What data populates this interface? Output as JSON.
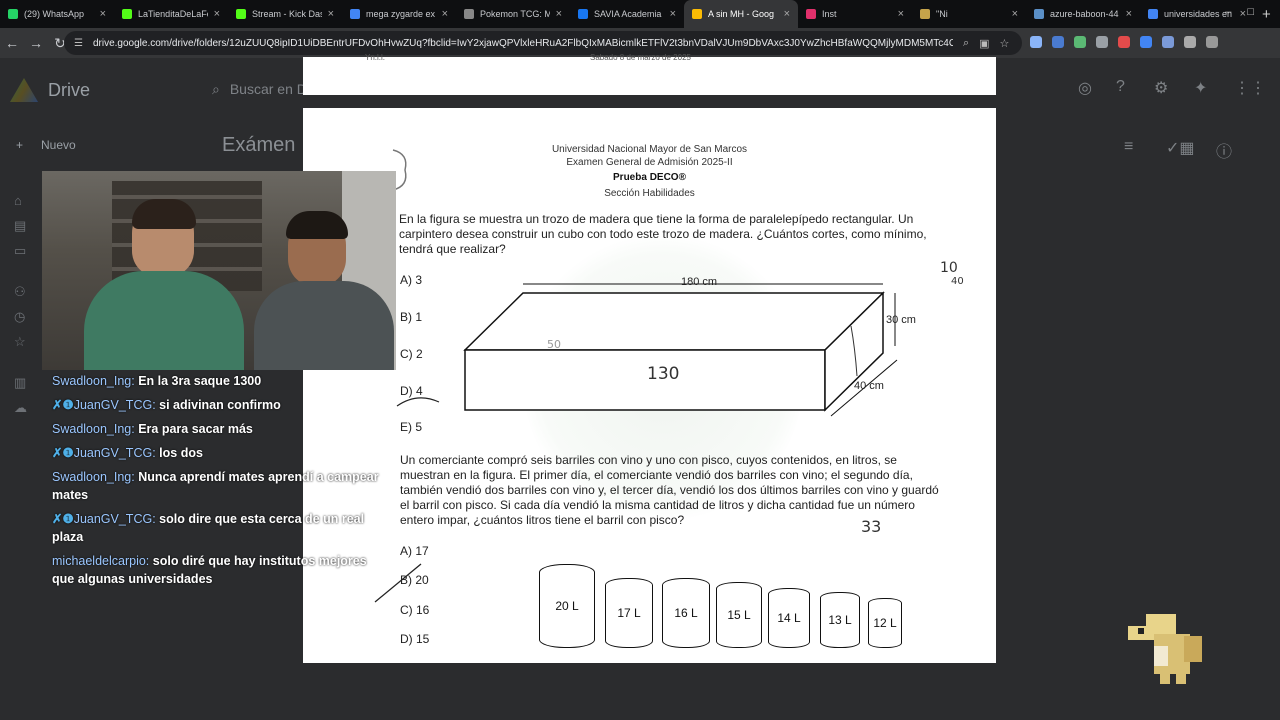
{
  "tabs": [
    {
      "title": "(29) WhatsApp",
      "color": "#25d366"
    },
    {
      "title": "LaTienditaDeLaFo",
      "color": "#53fc18"
    },
    {
      "title": "Stream - Kick Das",
      "color": "#53fc18"
    },
    {
      "title": "mega zygarde ex",
      "color": "#4285f4"
    },
    {
      "title": "Pokemon TCG: M",
      "color": "#888888"
    },
    {
      "title": "SAVIA Academia",
      "color": "#1877f2"
    },
    {
      "title": "A sin MH - Goog",
      "color": "#fbbc04",
      "active": true
    },
    {
      "title": "Inst",
      "color": "#e1306c"
    },
    {
      "title": "\"Ni",
      "color": "#c5a34a"
    },
    {
      "title": "azure-baboon-44",
      "color": "#5a8fc7"
    },
    {
      "title": "universidades en",
      "color": "#4285f4"
    }
  ],
  "browser": {
    "url": "drive.google.com/drive/folders/12uZUUQ8ipID1UiDBEntrUFDvOhHvwZUq?fbclid=IwY2xjawQPVlxleHRuA2FlbQIxMABicmlkETFlV2t3bnVDalVJUm9DbVAxc3J0YwZhcHBfaWQQMjlyMDM5MTc4ODIwM..."
  },
  "drive": {
    "logo_text": "Drive",
    "search_placeholder": "Buscar en Drive",
    "new_label": "Nuevo",
    "title": "Exámen"
  },
  "doc_strip": {
    "left": "Yn.l.l.",
    "center": "Sabado 8 de marzo de 2025"
  },
  "exam": {
    "header": [
      "Universidad Nacional Mayor de San Marcos",
      "Examen General de Admisión 2025-II",
      "Prueba DECO®",
      "Sección Habilidades"
    ],
    "q1": "En la figura se muestra un trozo de madera que tiene la forma de paralelepípedo rectangular. Un carpintero desea construir un cubo con todo este trozo de madera. ¿Cuántos cortes, como mínimo, tendrá que realizar?",
    "q1_options": [
      "A)  3",
      "B)  1",
      "C)  2",
      "D)  4",
      "E)  5"
    ],
    "dims": {
      "length": "180 cm",
      "height": "30 cm",
      "depth": "40 cm"
    },
    "q2": "Un comerciante compró seis barriles con vino y uno con pisco, cuyos contenidos, en litros, se muestran en la figura. El primer día, el comerciante vendió dos barriles con vino; el segundo día, también vendió dos barriles con vino y, el tercer día, vendió los dos últimos barriles con vino y guardó el barril con pisco. Si cada día vendió la misma cantidad de litros y dicha cantidad fue un número entero impar, ¿cuántos litros tiene el barril con pisco?",
    "q2_options": [
      "A)  17",
      "B)  20",
      "C)  16",
      "D)  15"
    ],
    "barrels": [
      "20 L",
      "17 L",
      "16 L",
      "15 L",
      "14 L",
      "13 L",
      "12 L"
    ],
    "handwriting": {
      "a": "10",
      "b": "40",
      "c": "130",
      "d": "33",
      "e": "50"
    }
  },
  "chat": [
    {
      "user": "Swadloon_Ing:",
      "badge": "",
      "text": "En la 3ra saque 1300"
    },
    {
      "user": "JuanGV_TCG:",
      "badge": "✗❶",
      "text": "si adivinan confirmo"
    },
    {
      "user": "Swadloon_Ing:",
      "badge": "",
      "text": "Era para sacar más"
    },
    {
      "user": "JuanGV_TCG:",
      "badge": "✗❶",
      "text": "los dos"
    },
    {
      "user": "Swadloon_Ing:",
      "badge": "",
      "text": "Nunca aprendí mates aprendí a campear mates"
    },
    {
      "user": "JuanGV_TCG:",
      "badge": "✗❶",
      "text": "solo dire que esta cerca de un real plaza"
    },
    {
      "user": "michaeldelcarpio:",
      "badge": "",
      "text": "solo diré que hay institutos mejores que algunas universidades"
    }
  ]
}
